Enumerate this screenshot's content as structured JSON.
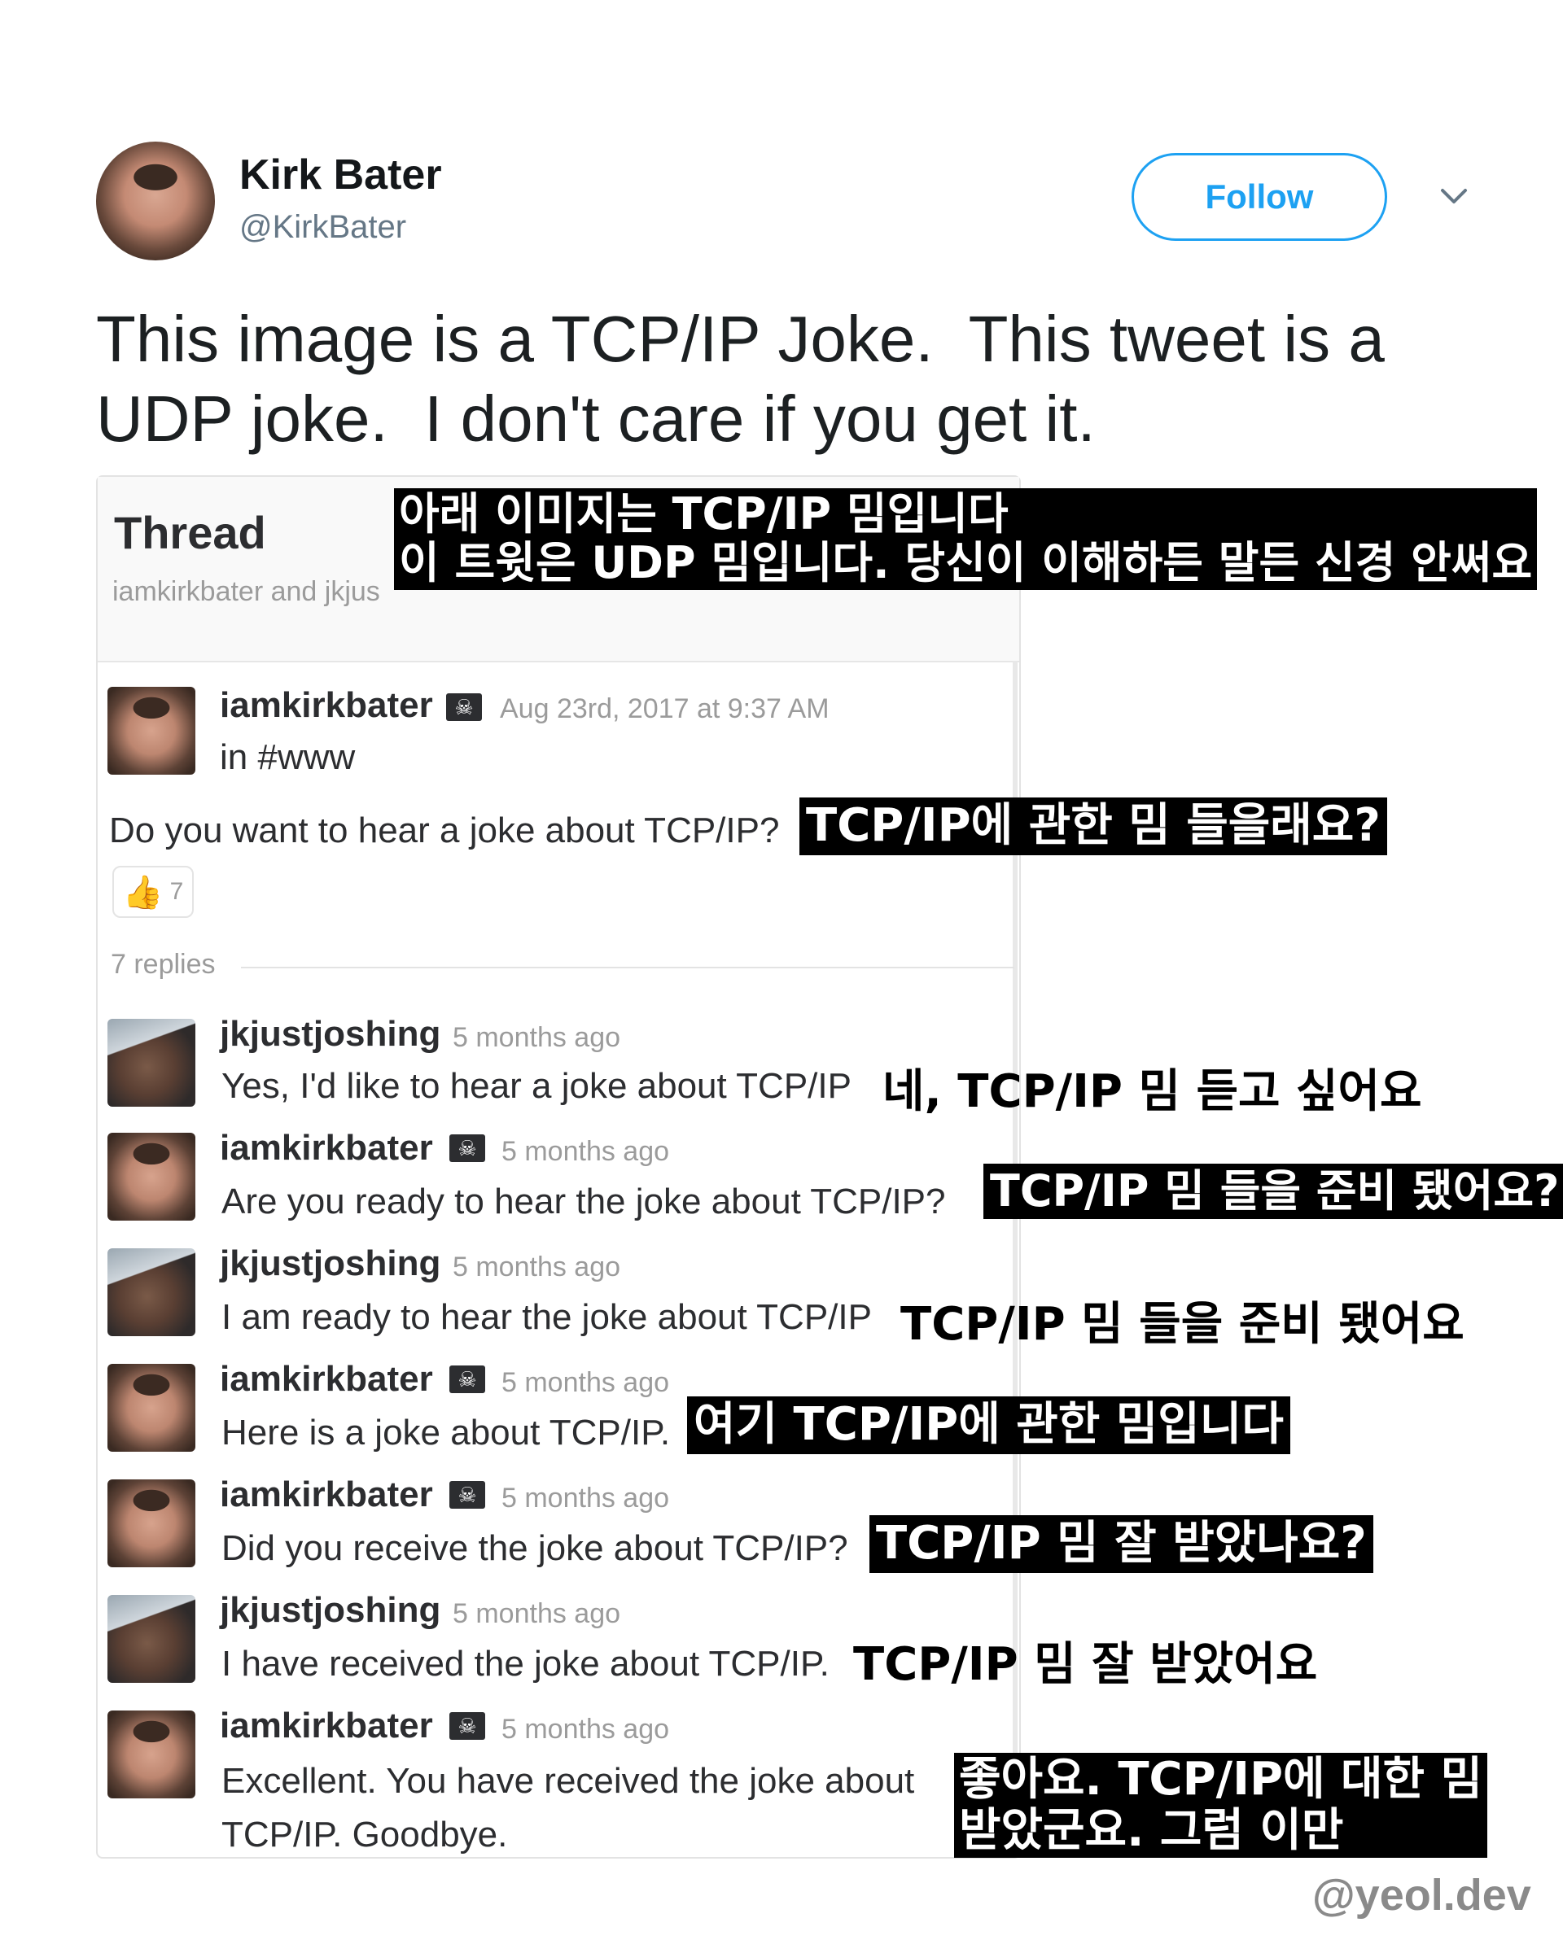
{
  "tweet": {
    "author_name": "Kirk Bater",
    "author_handle": "@KirkBater",
    "follow_label": "Follow",
    "text": "This image is a TCP/IP Joke.  This tweet is a\nUDP joke.  I don't care if you get it."
  },
  "thread": {
    "title": "Thread",
    "subtitle": "iamkirkbater and jkjus",
    "original": {
      "user": "iamkirkbater",
      "time": "Aug 23rd, 2017 at 9:37 AM",
      "channel": "in #www",
      "text": "Do you want to hear a joke about TCP/IP?",
      "reaction_count": "7"
    },
    "replies_label": "7 replies",
    "replies": [
      {
        "user": "jkjustjoshing",
        "time": "5 months ago",
        "text": "Yes, I'd like to hear a joke about TCP/IP"
      },
      {
        "user": "iamkirkbater",
        "time": "5 months ago",
        "text": "Are you ready to hear the joke about TCP/IP?"
      },
      {
        "user": "jkjustjoshing",
        "time": "5 months ago",
        "text": "I am ready to hear the joke about TCP/IP"
      },
      {
        "user": "iamkirkbater",
        "time": "5 months ago",
        "text": "Here is a joke about TCP/IP."
      },
      {
        "user": "iamkirkbater",
        "time": "5 months ago",
        "text": "Did you receive the joke about TCP/IP?"
      },
      {
        "user": "jkjustjoshing",
        "time": "5 months ago",
        "text": "I have received the joke about TCP/IP."
      },
      {
        "user": "iamkirkbater",
        "time": "5 months ago",
        "text": "Excellent.  You have received the joke about",
        "text2": "TCP/IP.  Goodbye."
      }
    ]
  },
  "subtitles": {
    "header": "아래 이미지는 TCP/IP 밈입니다\n이 트윗은 UDP 밈입니다. 당신이 이해하든 말든 신경 안써요",
    "s0": "TCP/IP에 관한 밈 들을래요?",
    "s1": "네, TCP/IP 밈 듣고 싶어요",
    "s2": "TCP/IP 밈 들을 준비 됐어요?",
    "s3": "TCP/IP 밈 들을 준비 됐어요",
    "s4": "여기 TCP/IP에 관한 밈입니다",
    "s5": "TCP/IP 밈 잘 받았나요?",
    "s6": "TCP/IP 밈 잘 받았어요",
    "s7": "좋아요. TCP/IP에 대한 밈\n받았군요. 그럼 이만"
  },
  "watermark": "@yeol.dev",
  "colors": {
    "accent": "#1da1f2",
    "subtitle_bg": "#000000"
  }
}
